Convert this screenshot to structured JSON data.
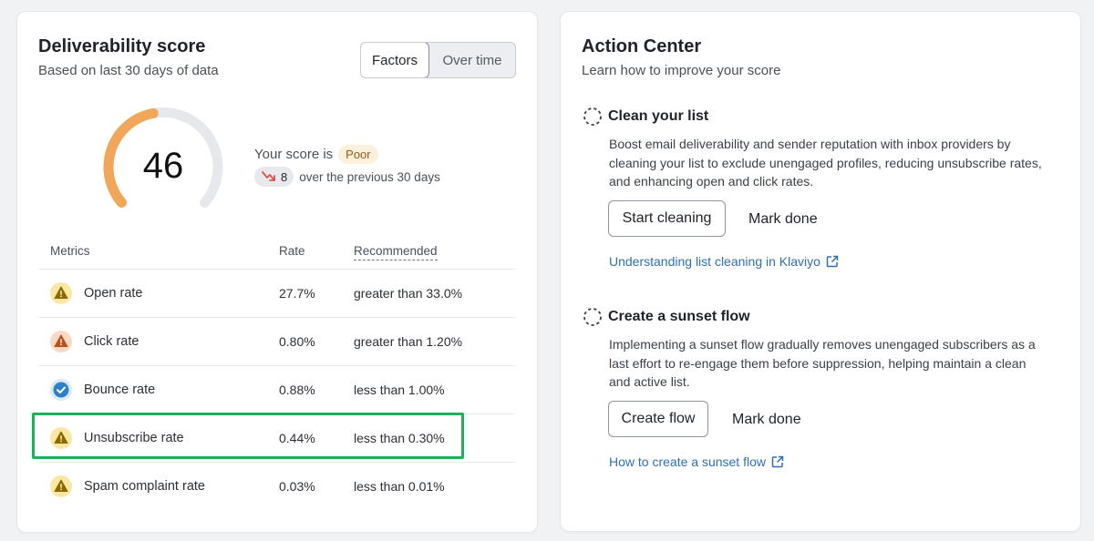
{
  "deliverability": {
    "title": "Deliverability score",
    "subtitle": "Based on last 30 days of data",
    "toggle": {
      "factors": "Factors",
      "over_time": "Over time",
      "active": "factors"
    },
    "score": {
      "value": "46",
      "level": 0.46,
      "color": "#f0a75a",
      "track_color": "#e6e8eb"
    },
    "score_text": "Your score is",
    "badge": "Poor",
    "change": {
      "value": "8",
      "text": "over the previous 30 days",
      "direction": "down",
      "color": "#d9534f"
    },
    "table": {
      "headers": {
        "metrics": "Metrics",
        "rate": "Rate",
        "recommended": "Recommended"
      },
      "rows": [
        {
          "name": "Open rate",
          "rate": "27.7%",
          "recommended": "greater than 33.0%",
          "status": "warning-yellow"
        },
        {
          "name": "Click rate",
          "rate": "0.80%",
          "recommended": "greater than 1.20%",
          "status": "warning-orange"
        },
        {
          "name": "Bounce rate",
          "rate": "0.88%",
          "recommended": "less than 1.00%",
          "status": "ok"
        },
        {
          "name": "Unsubscribe rate",
          "rate": "0.44%",
          "recommended": "less than 0.30%",
          "status": "warning-yellow"
        },
        {
          "name": "Spam complaint rate",
          "rate": "0.03%",
          "recommended": "less than 0.01%",
          "status": "warning-yellow"
        }
      ]
    }
  },
  "action_center": {
    "title": "Action Center",
    "subtitle": "Learn how to improve your score",
    "tasks": [
      {
        "title": "Clean your list",
        "description": "Boost email deliverability and sender reputation with inbox providers by cleaning your list to exclude unengaged profiles, reducing unsubscribe rates, and enhancing open and click rates.",
        "primary": "Start cleaning",
        "secondary": "Mark done",
        "link": "Understanding list cleaning in Klaviyo"
      },
      {
        "title": "Create a sunset flow",
        "description": "Implementing a sunset flow gradually removes unengaged subscribers as a last effort to re-engage them before suppression, helping maintain a clean and active list.",
        "primary": "Create flow",
        "secondary": "Mark done",
        "link": "How to create a sunset flow"
      }
    ]
  },
  "colors": {
    "highlight": "#19b35a",
    "link": "#2f6fb5",
    "warning_yellow_bg": "#fbe7a3",
    "warning_yellow_fg": "#8a6a00",
    "warning_orange_bg": "#fbd9c4",
    "warning_orange_fg": "#b5521a",
    "ok": "#2f7fc6"
  }
}
